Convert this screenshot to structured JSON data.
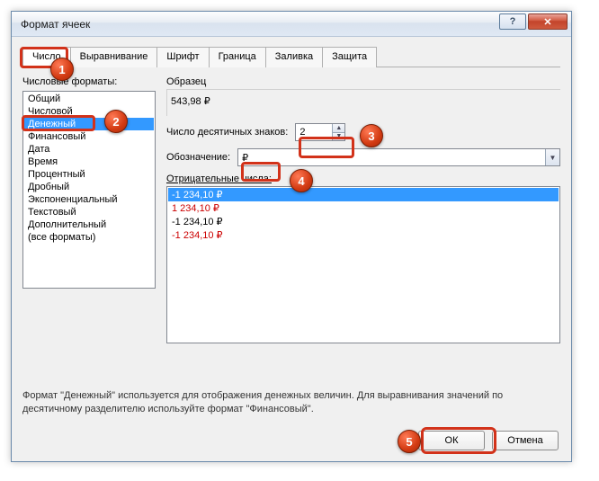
{
  "window": {
    "title": "Формат ячеек"
  },
  "tabs": [
    {
      "label": "Число",
      "active": true
    },
    {
      "label": "Выравнивание",
      "active": false
    },
    {
      "label": "Шрифт",
      "active": false
    },
    {
      "label": "Граница",
      "active": false
    },
    {
      "label": "Заливка",
      "active": false
    },
    {
      "label": "Защита",
      "active": false
    }
  ],
  "left": {
    "label": "Числовые форматы:",
    "categories": [
      "Общий",
      "Числовой",
      "Денежный",
      "Финансовый",
      "Дата",
      "Время",
      "Процентный",
      "Дробный",
      "Экспоненциальный",
      "Текстовый",
      "Дополнительный",
      "(все форматы)"
    ],
    "selected_index": 2
  },
  "right": {
    "sample_label": "Образец",
    "sample_value": "543,98 ₽",
    "decimals_label": "Число десятичных знаков:",
    "decimals_value": "2",
    "symbol_label": "Обозначение:",
    "symbol_value": "₽",
    "negatives_label": "Отрицательные числа:",
    "negatives": [
      {
        "text": "-1 234,10 ₽",
        "red": false,
        "selected": true
      },
      {
        "text": "1 234,10 ₽",
        "red": true,
        "selected": false
      },
      {
        "text": "-1 234,10 ₽",
        "red": false,
        "selected": false
      },
      {
        "text": "-1 234,10 ₽",
        "red": true,
        "selected": false
      }
    ]
  },
  "description": "Формат \"Денежный\" используется для отображения денежных величин. Для выравнивания значений по десятичному разделителю используйте формат \"Финансовый\".",
  "buttons": {
    "ok": "ОК",
    "cancel": "Отмена"
  },
  "markers": {
    "m1": "1",
    "m2": "2",
    "m3": "3",
    "m4": "4",
    "m5": "5"
  }
}
